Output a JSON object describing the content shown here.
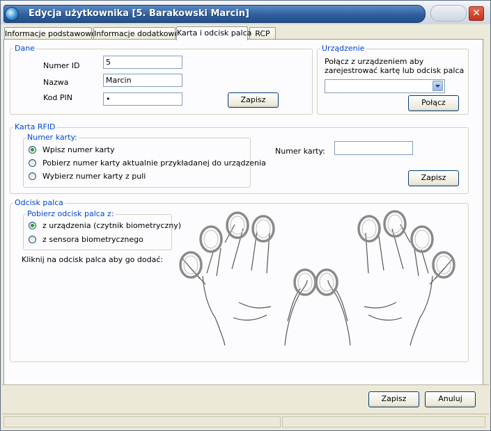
{
  "window": {
    "title": "Edycja użytkownika [5. Barakowski Marcin]",
    "close_label": "✕"
  },
  "tabs": [
    {
      "label": "Informacje podstawowe"
    },
    {
      "label": "Informacje dodatkowe"
    },
    {
      "label": "Karta i odcisk palca"
    },
    {
      "label": "RCP"
    }
  ],
  "dane": {
    "legend": "Dane",
    "numer_id_label": "Numer ID",
    "numer_id_value": "5",
    "nazwa_label": "Nazwa",
    "nazwa_value": "Marcin",
    "pin_label": "Kod PIN",
    "pin_value": "•",
    "save_label": "Zapisz"
  },
  "urzadzenie": {
    "legend": "Urządzenie",
    "desc_line1": "Połącz z urządzeniem aby",
    "desc_line2": "zarejestrować kartę lub odcisk palca",
    "select_value": "",
    "connect_label": "Połącz"
  },
  "rfid": {
    "legend": "Karta RFID",
    "sub_legend": "Numer karty:",
    "options": [
      {
        "label": "Wpisz numer karty",
        "selected": true
      },
      {
        "label": "Pobierz numer karty aktualnie przykładanej do urządzenia",
        "selected": false
      },
      {
        "label": "Wybierz numer karty z puli",
        "selected": false
      }
    ],
    "card_number_label": "Numer karty:",
    "card_number_value": "",
    "save_label": "Zapisz"
  },
  "fingerprint": {
    "legend": "Odcisk palca",
    "sub_legend": "Pobierz odcisk palca z:",
    "options": [
      {
        "label": "z urządzenia (czytnik biometryczny)",
        "selected": true
      },
      {
        "label": "z sensora biometrycznego",
        "selected": false
      }
    ],
    "hint": "Kliknij na odcisk palca aby go dodać:"
  },
  "footer": {
    "save_label": "Zapisz",
    "cancel_label": "Anuluj"
  },
  "colors": {
    "title_bar": "#2f5f9f",
    "group_legend": "#0046d5",
    "radio_dot": "#21a121",
    "close_button": "#c2341b"
  }
}
